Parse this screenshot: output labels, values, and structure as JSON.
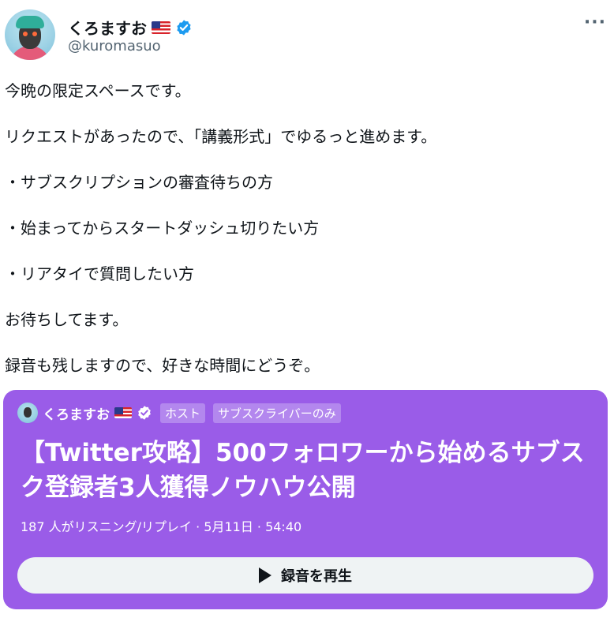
{
  "author": {
    "display_name": "くろますお",
    "handle": "@kuromasuo",
    "flag_icon": "us-flag-icon",
    "verified_icon": "verified-badge-icon"
  },
  "tweet": {
    "paragraphs": [
      "今晩の限定スペースです。",
      "リクエストがあったので、「講義形式」でゆるっと進めます。",
      "・サブスクリプションの審査待ちの方",
      "・始まってからスタートダッシュ切りたい方",
      "・リアタイで質問したい方",
      "お待ちしてます。",
      "録音も残しますので、好きな時間にどうぞ。"
    ]
  },
  "more_label": "···",
  "space": {
    "host_name": "くろますお",
    "tag_host": "ホスト",
    "tag_subscribers": "サブスクライバーのみ",
    "title": "【Twitter攻略】500フォロワーから始めるサブスク登録者3人獲得ノウハウ公開",
    "meta": "187 人がリスニング/リプレイ · 5月11日 · 54:40",
    "play_label": "録音を再生",
    "accent_color": "#9a5ce8"
  }
}
